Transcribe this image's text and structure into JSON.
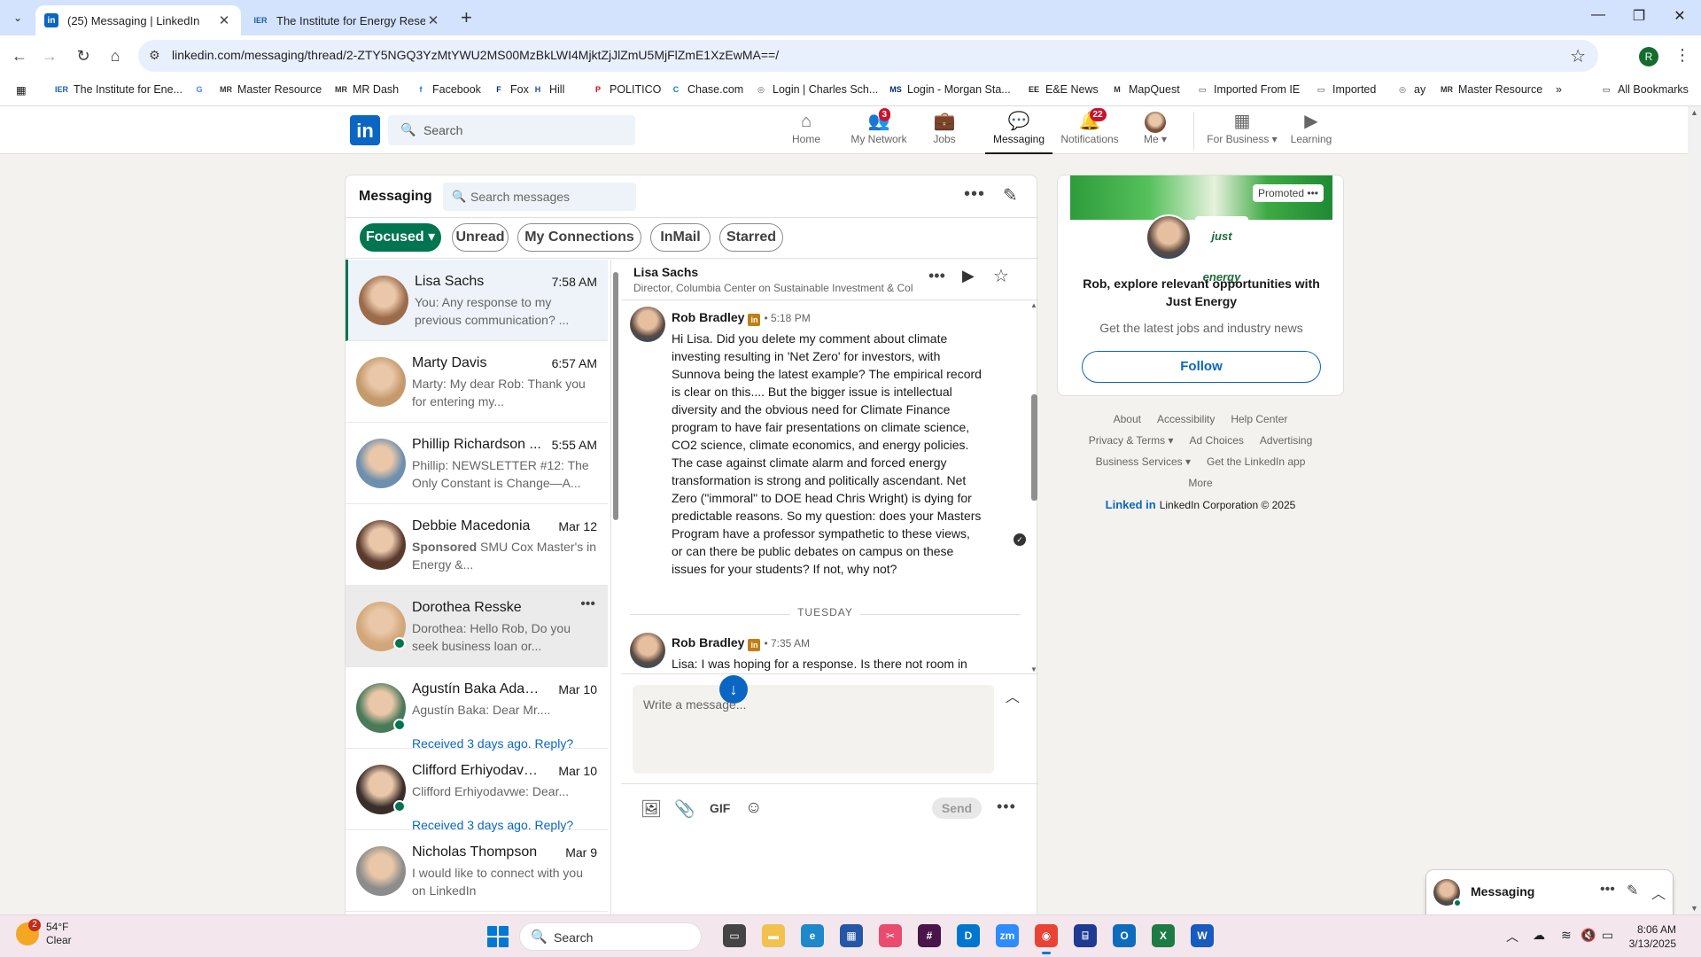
{
  "browser": {
    "tabs": [
      {
        "title": "(25) Messaging | LinkedIn",
        "favicon": "linkedin-icon",
        "active": true
      },
      {
        "title": "The Institute for Energy Research",
        "favicon": "ier-icon",
        "active": false
      }
    ],
    "url": "linkedin.com/messaging/thread/2-ZTY5NGQ3YzMtYWU2MS00MzBkLWI4MjktZjJlZmU5MjFlZmE1XzEwMA==/",
    "profile_initial": "R",
    "bookmarks": [
      {
        "label": "The Institute for Ene...",
        "icon": "IER",
        "color": "#1a5fa8"
      },
      {
        "label": "",
        "icon": "G",
        "color": "#4285f4"
      },
      {
        "label": "Master Resource",
        "icon": "MR",
        "color": "#333333"
      },
      {
        "label": "MR Dash",
        "icon": "MR",
        "color": "#333333"
      },
      {
        "label": "Facebook",
        "icon": "f",
        "color": "#1877f2"
      },
      {
        "label": "Fox",
        "icon": "F",
        "color": "#003366"
      },
      {
        "label": "Hill",
        "icon": "H",
        "color": "#1a4f9c"
      },
      {
        "label": "POLITICO",
        "icon": "P",
        "color": "#d6001c"
      },
      {
        "label": "Chase.com",
        "icon": "C",
        "color": "#117aca"
      },
      {
        "label": "Login | Charles Sch...",
        "icon": "◎",
        "color": "#555555"
      },
      {
        "label": "Login - Morgan Sta...",
        "icon": "MS",
        "color": "#002d72"
      },
      {
        "label": "E&E News",
        "icon": "EE",
        "color": "#222222"
      },
      {
        "label": "MapQuest",
        "icon": "M",
        "color": "#333333"
      },
      {
        "label": "Imported From IE",
        "icon": "folder",
        "color": "#333333"
      },
      {
        "label": "Imported",
        "icon": "folder",
        "color": "#333333"
      },
      {
        "label": "ay",
        "icon": "◎",
        "color": "#555555"
      },
      {
        "label": "Master Resource",
        "icon": "MR",
        "color": "#333333"
      }
    ],
    "all_bookmarks": "All Bookmarks"
  },
  "linkedin_nav": {
    "search_placeholder": "Search",
    "items": [
      {
        "label": "Home",
        "icon": "home-icon",
        "badge": ""
      },
      {
        "label": "My Network",
        "icon": "network-icon",
        "badge": "3"
      },
      {
        "label": "Jobs",
        "icon": "briefcase-icon",
        "badge": ""
      },
      {
        "label": "Messaging",
        "icon": "chat-icon",
        "badge": ""
      },
      {
        "label": "Notifications",
        "icon": "bell-icon",
        "badge": "22"
      },
      {
        "label": "Me",
        "icon": "avatar",
        "badge": ""
      },
      {
        "label": "For Business",
        "icon": "grid-icon",
        "badge": ""
      },
      {
        "label": "Learning",
        "icon": "learning-icon",
        "badge": ""
      }
    ]
  },
  "messaging": {
    "title": "Messaging",
    "search_placeholder": "Search messages",
    "filters": [
      "Focused",
      "Unread",
      "My Connections",
      "InMail",
      "Starred"
    ],
    "conversations": [
      {
        "name": "Lisa Sachs",
        "time": "7:58 AM",
        "snippet": "You: Any response to my previous communication?  ...",
        "sponsored": "",
        "reply": "",
        "online": false,
        "avatar": "#9b6b4b"
      },
      {
        "name": "Marty Davis",
        "time": "6:57 AM",
        "snippet": "Marty: My dear Rob: Thank you for entering my...",
        "sponsored": "",
        "reply": "",
        "online": false,
        "avatar": "#c49a6c"
      },
      {
        "name": "Phillip Richardson ...",
        "time": "5:55 AM",
        "snippet": "Phillip: NEWSLETTER #12: The Only Constant is Change—A...",
        "sponsored": "",
        "reply": "",
        "online": false,
        "avatar": "#6f8fae"
      },
      {
        "name": "Debbie Macedonia",
        "time": "Mar 12",
        "snippet": "SMU Cox Master's in Energy &...",
        "sponsored": "Sponsored",
        "reply": "",
        "online": false,
        "avatar": "#5b3a2e"
      },
      {
        "name": "Dorothea Resske",
        "time": "",
        "snippet": "Dorothea: Hello Rob, Do you seek business loan or...",
        "sponsored": "",
        "reply": "",
        "online": true,
        "avatar": "#d2a679"
      },
      {
        "name": "Agustín Baka Adam...",
        "time": "Mar 10",
        "snippet": "Agustín Baka: Dear Mr....",
        "sponsored": "",
        "reply": "Received 3 days ago. Reply?",
        "online": true,
        "avatar": "#4a7a5a"
      },
      {
        "name": "Clifford Erhiyodavwe...",
        "time": "Mar 10",
        "snippet": "Clifford Erhiyodavwe: Dear...",
        "sponsored": "",
        "reply": "Received 3 days ago. Reply?",
        "online": true,
        "avatar": "#3a2e2a"
      },
      {
        "name": "Nicholas Thompson",
        "time": "Mar 9",
        "snippet": "I would like to connect with you on LinkedIn",
        "sponsored": "",
        "reply": "",
        "online": false,
        "avatar": "#8c8c8c"
      }
    ],
    "thread": {
      "name": "Lisa Sachs",
      "headline": "Director, Columbia Center on Sustainable Investment & Col",
      "messages": [
        {
          "sender": "Rob Bradley",
          "time": "• 5:18 PM",
          "body": "Hi Lisa.  Did you delete my comment about climate investing resulting in 'Net Zero' for investors, with Sunnova being the latest example? The empirical record is clear on this....   But the bigger issue is intellectual diversity and the obvious need for Climate Finance program to have fair presentations on climate science, CO2 science, climate economics, and energy policies. The case against climate alarm and forced energy transformation is strong and politically ascendant. Net Zero (\"immoral\" to DOE head Chris Wright) is dying for predictable reasons. So my question: does your Masters Program have a professor sympathetic to these views, or can there be public debates on campus on these issues for your students? If not, why not?"
        },
        {
          "sender": "Rob Bradley",
          "time": "• 7:35 AM",
          "body": "Lisa: I was hoping for a response.  Is there not room in Climate Finance for a different perspective on climate alarm and forced energy transformation?"
        }
      ],
      "day_divider": "TUESDAY",
      "composer_placeholder": "Write a message...",
      "gif_label": "GIF",
      "send_label": "Send"
    }
  },
  "ad": {
    "promoted": "Promoted",
    "logo_text": "just energy",
    "title": "Rob, explore relevant opportunities with Just Energy",
    "subtitle": "Get the latest jobs and industry news",
    "follow": "Follow"
  },
  "footer": {
    "links": [
      [
        "About",
        "Accessibility",
        "Help Center"
      ],
      [
        "Privacy & Terms ▾",
        "Ad Choices",
        "Advertising"
      ],
      [
        "Business Services ▾",
        "Get the LinkedIn app"
      ],
      [
        "More"
      ]
    ],
    "brand": "Linked in",
    "corp": "LinkedIn Corporation © 2025"
  },
  "overlay": {
    "label": "Messaging"
  },
  "taskbar": {
    "weather_temp": "54°F",
    "weather_desc": "Clear",
    "weather_badge": "2",
    "search_placeholder": "Search",
    "time": "8:06 AM",
    "date": "3/13/2025"
  }
}
